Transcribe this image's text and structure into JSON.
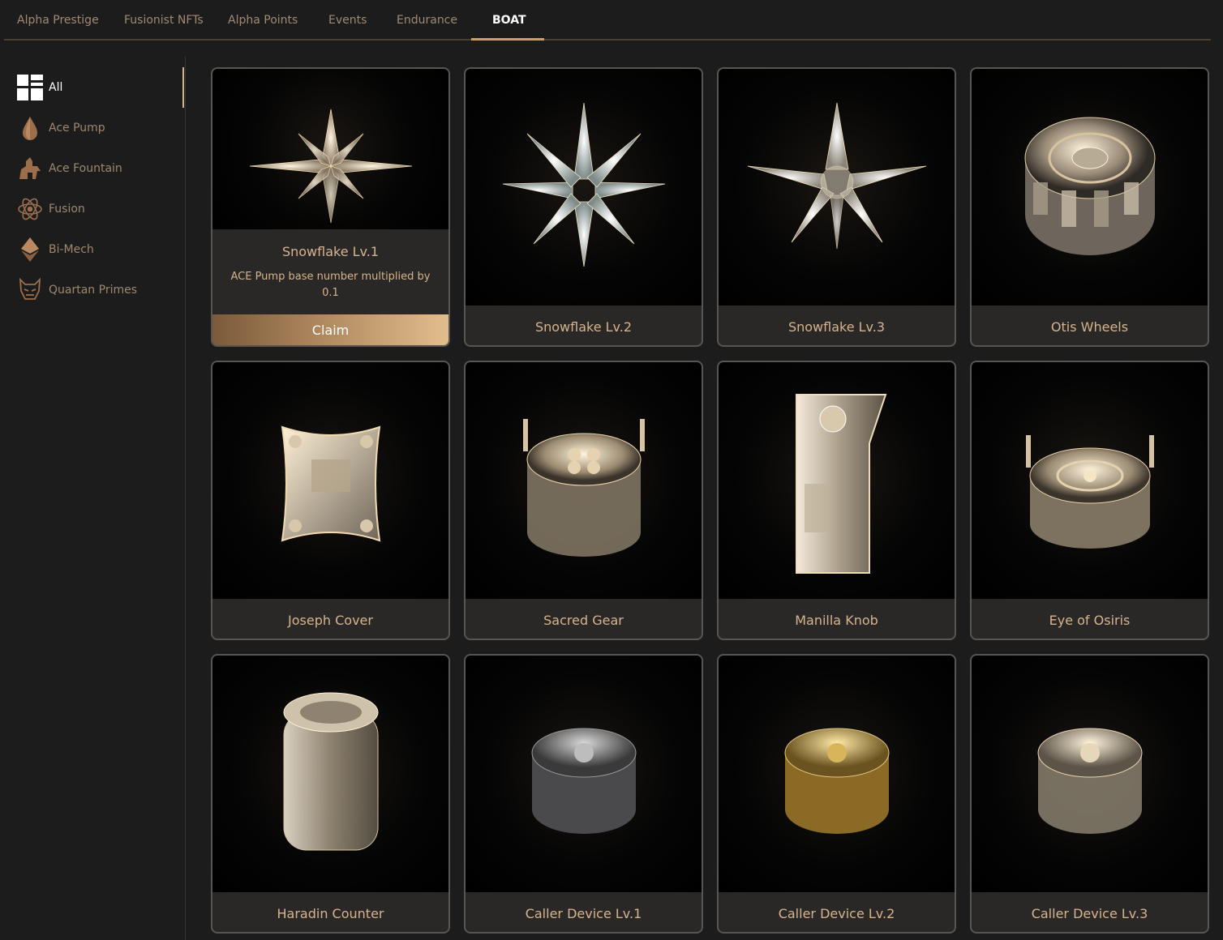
{
  "topnav": {
    "tabs": [
      {
        "label": "Alpha Prestige"
      },
      {
        "label": "Fusionist NFTs"
      },
      {
        "label": "Alpha Points"
      },
      {
        "label": "Events"
      },
      {
        "label": "Endurance"
      },
      {
        "label": "BOAT"
      }
    ],
    "active_tab": "BOAT"
  },
  "sidebar": {
    "items": [
      {
        "label": "All",
        "icon": "grid-icon"
      },
      {
        "label": "Ace Pump",
        "icon": "drop-icon"
      },
      {
        "label": "Ace Fountain",
        "icon": "fountain-icon"
      },
      {
        "label": "Fusion",
        "icon": "atom-icon"
      },
      {
        "label": "Bi-Mech",
        "icon": "diamond-icon"
      },
      {
        "label": "Quartan Primes",
        "icon": "mask-icon"
      }
    ],
    "active": "All"
  },
  "items": [
    {
      "name": "Snowflake Lv.1",
      "description": "ACE Pump base number multiplied by 0.1",
      "button": "Claim",
      "art": "snowflake-1"
    },
    {
      "name": "Snowflake Lv.2",
      "art": "snowflake-2"
    },
    {
      "name": "Snowflake Lv.3",
      "art": "snowflake-3"
    },
    {
      "name": "Otis Wheels",
      "art": "wheel"
    },
    {
      "name": "Joseph Cover",
      "art": "cover"
    },
    {
      "name": "Sacred Gear",
      "art": "gear"
    },
    {
      "name": "Manilla Knob",
      "art": "knob"
    },
    {
      "name": "Eye of Osiris",
      "art": "eye"
    },
    {
      "name": "Haradin Counter",
      "art": "counter"
    },
    {
      "name": "Caller Device Lv.1",
      "art": "device-silver"
    },
    {
      "name": "Caller Device Lv.2",
      "art": "device-gold"
    },
    {
      "name": "Caller Device Lv.3",
      "art": "device-crystal"
    }
  ],
  "colors": {
    "background": "#1c1c1c",
    "accent_gold": "#c9a06b",
    "text_gold": "#d6b48f",
    "card_border": "#595550"
  }
}
